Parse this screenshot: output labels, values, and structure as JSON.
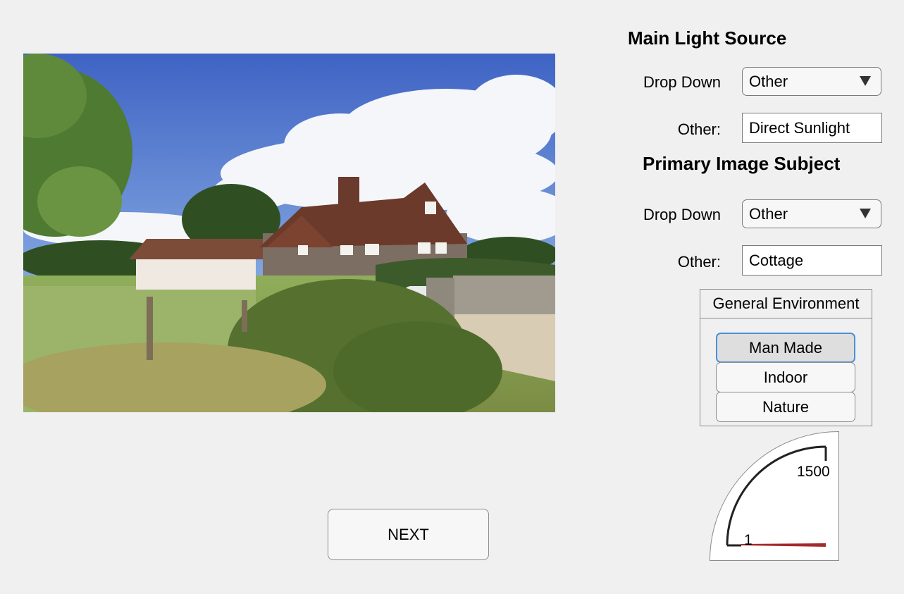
{
  "light_source": {
    "heading": "Main Light Source",
    "dropdown_label": "Drop Down",
    "dropdown_value": "Other",
    "other_label": "Other:",
    "other_value": "Direct Sunlight"
  },
  "subject": {
    "heading": "Primary Image Subject",
    "dropdown_label": "Drop Down",
    "dropdown_value": "Other",
    "other_label": "Other:",
    "other_value": "Cottage"
  },
  "environment": {
    "title": "General Environment",
    "options": [
      "Man Made",
      "Indoor",
      "Nature"
    ],
    "selected": "Man Made"
  },
  "gauge": {
    "min_label": "1",
    "max_label": "1500",
    "needle_color": "#a52a2a",
    "value": 1
  },
  "next_label": "NEXT"
}
